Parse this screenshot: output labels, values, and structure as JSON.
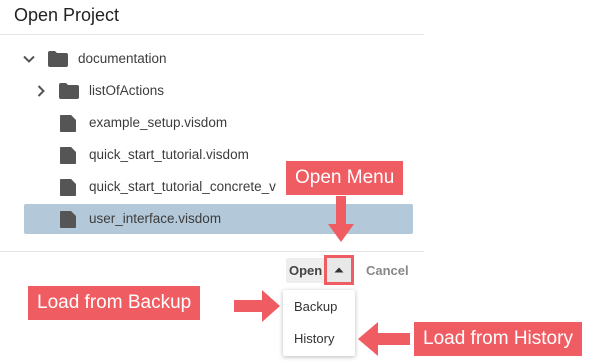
{
  "dialog": {
    "title": "Open Project"
  },
  "tree": [
    {
      "label": "documentation",
      "type": "folder",
      "expanded": true,
      "selected": false
    },
    {
      "label": "listOfActions",
      "type": "folder",
      "expanded": false,
      "selected": false
    },
    {
      "label": "example_setup.visdom",
      "type": "file",
      "selected": false
    },
    {
      "label": "quick_start_tutorial.visdom",
      "type": "file",
      "selected": false
    },
    {
      "label": "quick_start_tutorial_concrete_v",
      "type": "file",
      "selected": false
    },
    {
      "label": "user_interface.visdom",
      "type": "file",
      "selected": true
    }
  ],
  "buttons": {
    "open_label": "Open",
    "cancel_label": "Cancel",
    "dropdown_icon": "caret-up-icon"
  },
  "menu": {
    "items": [
      "Backup",
      "History"
    ]
  },
  "annotations": {
    "open_menu": "Open Menu",
    "load_backup": "Load from Backup",
    "load_history": "Load from History"
  },
  "colors": {
    "accent": "#ef5d63",
    "selected_row": "#b3c9d9",
    "icon": "#555555"
  }
}
